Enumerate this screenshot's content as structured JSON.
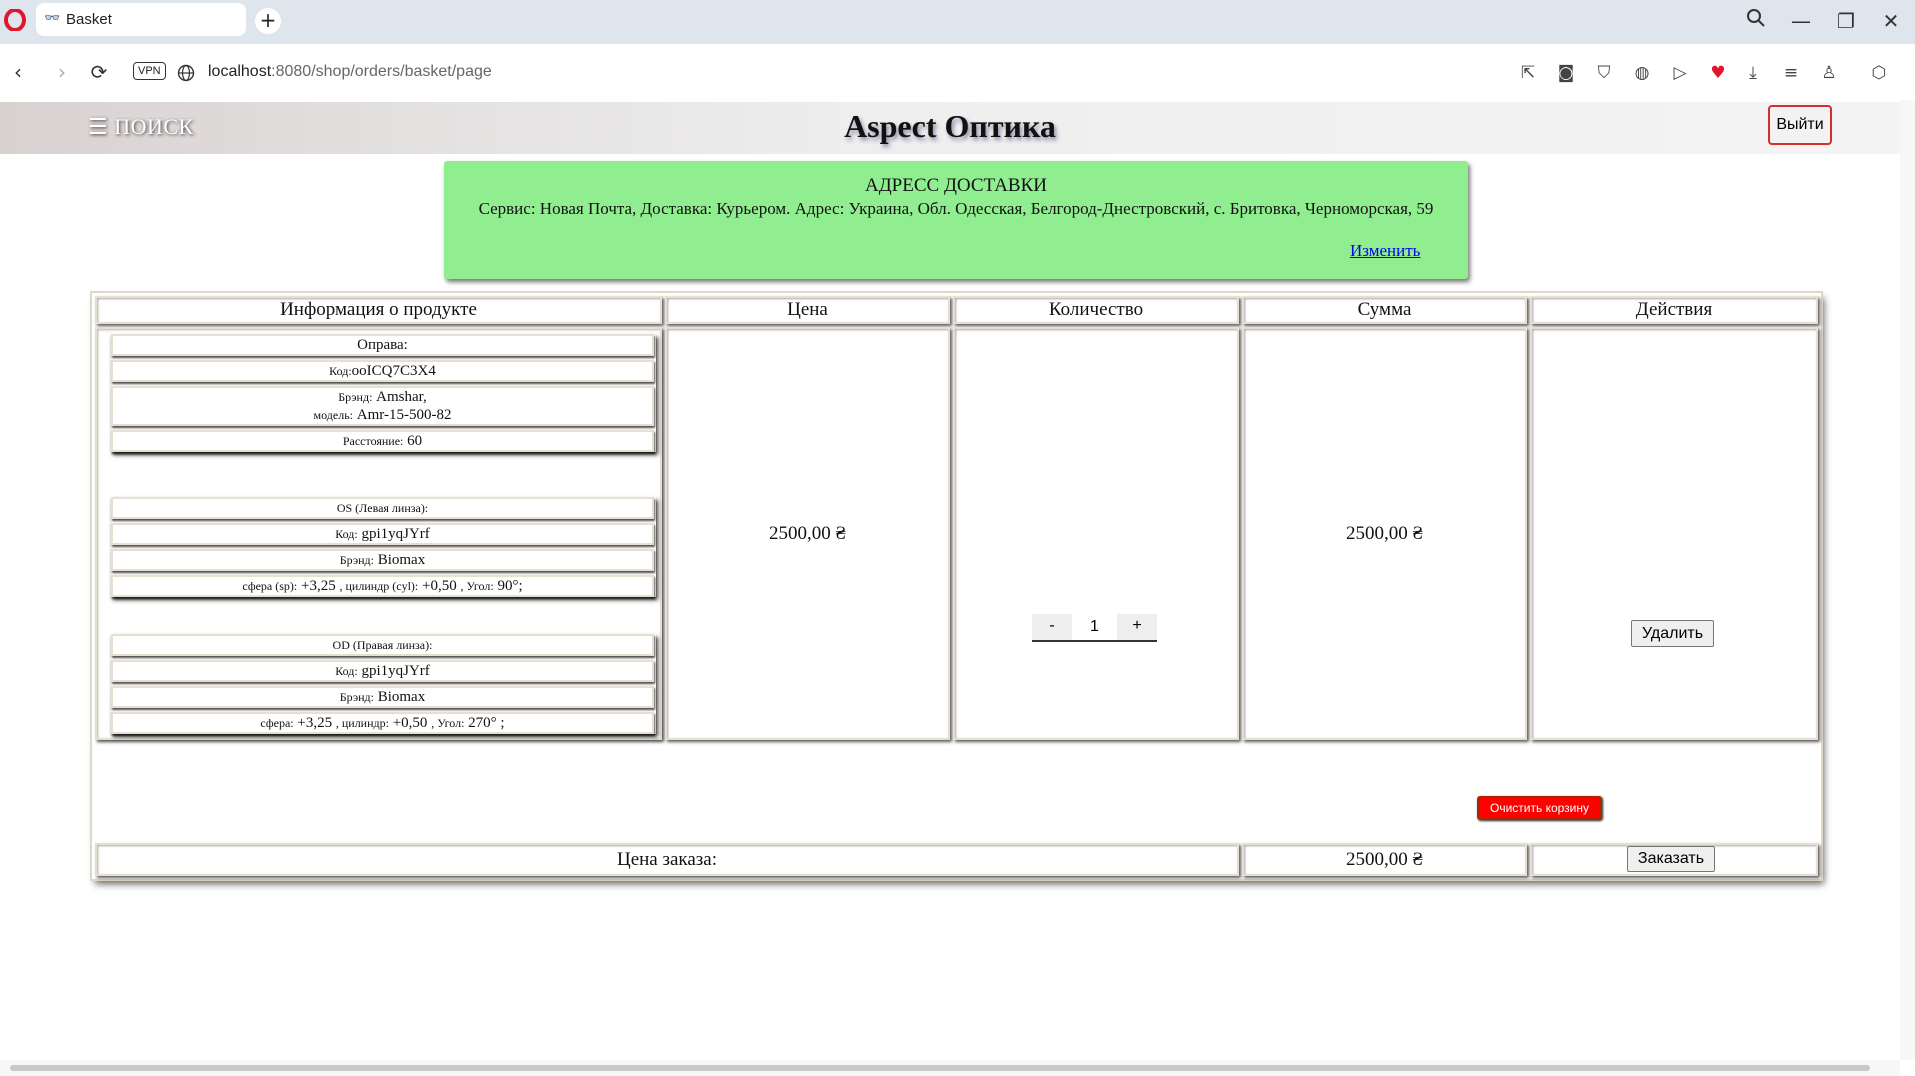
{
  "browser": {
    "tab_title": "Basket",
    "vpn_label": "VPN",
    "url_host": "localhost",
    "url_rest": ":8080/shop/orders/basket/page"
  },
  "header": {
    "menu_label": "☰ ПОИСК",
    "brand": "Aspect Оптика",
    "logout_label": "Выйти"
  },
  "delivery": {
    "heading": "АДРЕСС ДОСТАВКИ",
    "text": "Сервис: Новая Почта, Доставка: Курьером. Адрес: Украина, Обл. Одесская, Белгород-Днестровский, с. Бритовка, Черноморская, 59",
    "change_link": "Изменить"
  },
  "table": {
    "headers": [
      "Информация о продукте",
      "Цена",
      "Количество",
      "Сумма",
      "Действия"
    ],
    "item": {
      "frame": {
        "title": "Оправа:",
        "code_label": "Код:",
        "code": "ooICQ7C3X4",
        "brand_label": "Брэнд:",
        "brand": "Amshar,",
        "model_label": "модель:",
        "model": "Amr-15-500-82",
        "distance_label": "Расстояние:",
        "distance": "60"
      },
      "left_lens": {
        "title": "OS (Левая линза):",
        "code_label": "Код:",
        "code": "gpi1yqJYrf",
        "brand_label": "Брэнд:",
        "brand": "Biomax",
        "sph_label": "сфера (sp):",
        "sph": "+3,25",
        "cyl_label": ", цилиндр (cyl):",
        "cyl": "+0,50",
        "angle_label": ", Угол:",
        "angle": "90°;"
      },
      "right_lens": {
        "title": "OD (Правая линза):",
        "code_label": "Код:",
        "code": "gpi1yqJYrf",
        "brand_label": "Брэнд:",
        "brand": "Biomax",
        "sph_label": "сфера:",
        "sph": "+3,25",
        "cyl_label": ", цилиндр:",
        "cyl": "+0,50",
        "angle_label": ", Угол:",
        "angle": "270° ;"
      },
      "price": "2500,00 ₴",
      "qty_minus": "-",
      "quantity": "1",
      "qty_plus": "+",
      "sum": "2500,00 ₴",
      "delete_label": "Удалить"
    },
    "footer": {
      "label": "Цена заказа:",
      "total": "2500,00 ₴",
      "order_label": "Заказать"
    }
  },
  "clear_basket_label": "Очистить корзину",
  "colors": {
    "address_bg": "#90ee90",
    "clear_btn": "#ff0000",
    "logout_border": "#d32f2f"
  }
}
